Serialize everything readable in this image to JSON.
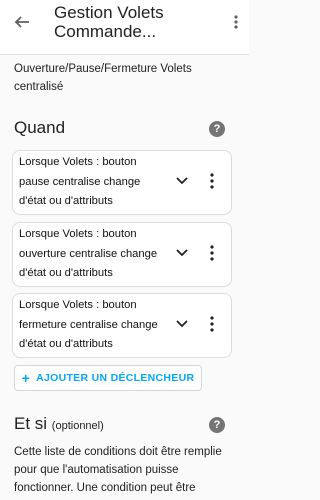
{
  "header": {
    "title_line1": "Gestion Volets",
    "title_line2": "Commande..."
  },
  "description": "Ouverture/Pause/Fermeture Volets centralisé",
  "triggers_section": {
    "title": "Quand",
    "cards": [
      {
        "line1": "Lorsque Volets : bouton",
        "line2": "pause centralise change",
        "line3": "d'état ou d'attributs"
      },
      {
        "line1": "Lorsque Volets : bouton",
        "line2": "ouverture centralise change",
        "line3": "d'état ou d'attributs"
      },
      {
        "line1": "Lorsque Volets : bouton",
        "line2": "fermeture centralise change",
        "line3": "d'état ou d'attributs"
      }
    ],
    "add_label": "AJOUTER UN DÉCLENCHEUR"
  },
  "conditions_section": {
    "title": "Et si",
    "optional": "(optionnel)",
    "description_visible": "Cette liste de conditions doit être remplie pour que l'automatisation puisse fonctionner. Une condition peut être"
  },
  "colors": {
    "accent": "#03a9f4",
    "icon_gray": "#757575",
    "card_border": "#dcdcdc"
  },
  "icons": [
    "back-arrow-icon",
    "more-vertical-icon",
    "help-icon",
    "chevron-down-icon",
    "plus-icon"
  ]
}
